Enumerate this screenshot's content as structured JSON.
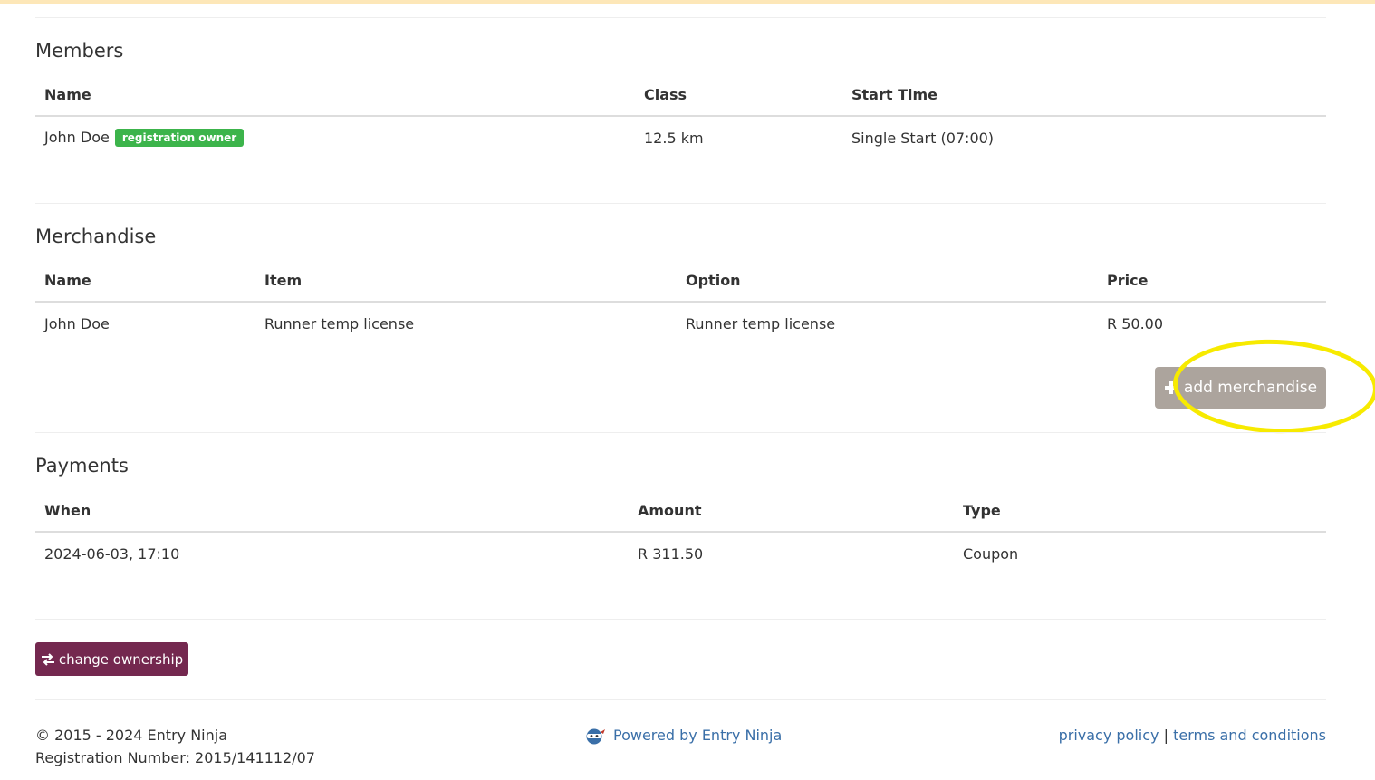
{
  "members": {
    "title": "Members",
    "headers": [
      "Name",
      "Class",
      "Start Time"
    ],
    "rows": [
      {
        "name": "John Doe",
        "badge": "registration owner",
        "class": "12.5 km",
        "start_time": "Single Start (07:00)"
      }
    ]
  },
  "merchandise": {
    "title": "Merchandise",
    "headers": [
      "Name",
      "Item",
      "Option",
      "Price"
    ],
    "rows": [
      {
        "name": "John Doe",
        "item": "Runner temp license",
        "option": "Runner temp license",
        "price": "R 50.00"
      }
    ],
    "add_button": "add merchandise"
  },
  "payments": {
    "title": "Payments",
    "headers": [
      "When",
      "Amount",
      "Type"
    ],
    "rows": [
      {
        "when": "2024-06-03, 17:10",
        "amount": "R 311.50",
        "type": "Coupon"
      }
    ]
  },
  "actions": {
    "change_ownership": "change ownership"
  },
  "footer": {
    "copyright": "© 2015 - 2024 Entry Ninja",
    "registration_number": "Registration Number: 2015/141112/07",
    "powered_by": "Powered by Entry Ninja",
    "privacy_policy": "privacy policy",
    "separator": "|",
    "terms": "terms and conditions"
  },
  "colors": {
    "badge": "#3cb44b",
    "add_button": "#aca49d",
    "change_ownership_button": "#74284f",
    "link": "#3a6fa8",
    "highlight": "#f7ea00"
  },
  "icons": {
    "add_merchandise": "plus-icon",
    "change_ownership": "exchange-arrows-icon",
    "powered_by": "entry-ninja-logo-icon"
  }
}
